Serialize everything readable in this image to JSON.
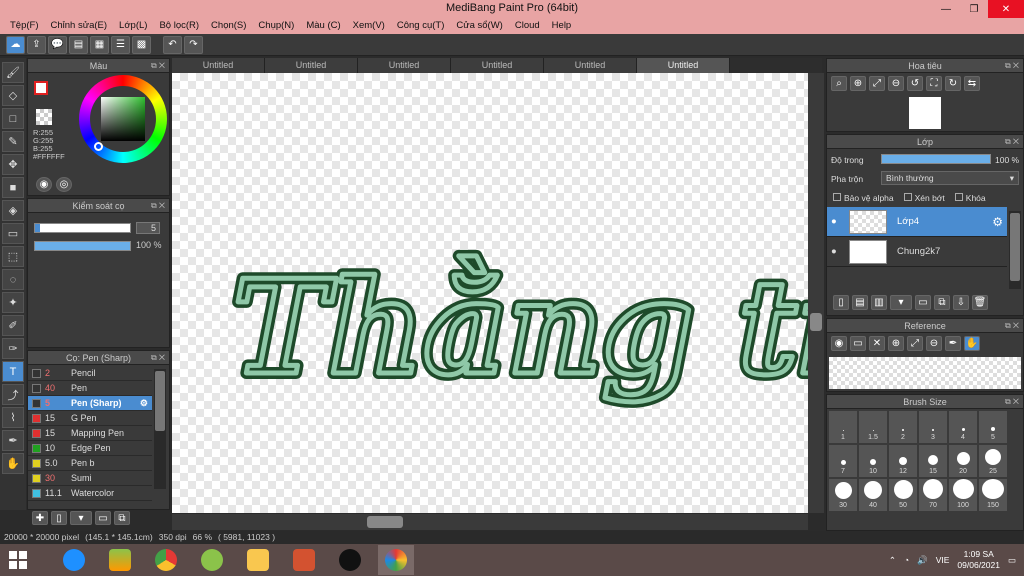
{
  "window": {
    "title": "MediBang Paint Pro (64bit)"
  },
  "menu": [
    "Tệp(F)",
    "Chỉnh sửa(E)",
    "Lớp(L)",
    "Bộ lọc(R)",
    "Chọn(S)",
    "Chụp(N)",
    "Màu (C)",
    "Xem(V)",
    "Công cụ(T)",
    "Cửa sổ(W)",
    "Cloud",
    "Help"
  ],
  "color_panel": {
    "title": "Màu",
    "r": "R:255",
    "g": "G:255",
    "b": "B:255",
    "hex": "#FFFFFF"
  },
  "brush_control": {
    "title": "Kiểm soát cọ",
    "size": "5",
    "opacity": "100 %"
  },
  "brush_panel": {
    "title": "Cọ: Pen (Sharp)",
    "items": [
      {
        "size": "2",
        "name": "Pencil",
        "color": "#333333"
      },
      {
        "size": "40",
        "name": "Pen",
        "color": "#333333"
      },
      {
        "size": "5",
        "name": "Pen (Sharp)",
        "color": "#333333"
      },
      {
        "size": "15",
        "name": "G Pen",
        "color": "#e03030"
      },
      {
        "size": "15",
        "name": "Mapping Pen",
        "color": "#e03030"
      },
      {
        "size": "10",
        "name": "Edge Pen",
        "color": "#20a020"
      },
      {
        "size": "5.0",
        "name": "Pen b",
        "color": "#e0d020"
      },
      {
        "size": "30",
        "name": "Sumi",
        "color": "#e0d020"
      },
      {
        "size": "11.1",
        "name": "Watercolor",
        "color": "#40c0e0"
      }
    ]
  },
  "tabs": [
    "Untitled",
    "Untitled",
    "Untitled",
    "Untitled",
    "Untitled",
    "Untitled"
  ],
  "canvas_text": "Thằng tiến",
  "navigator": {
    "title": "Hoa tiêu"
  },
  "layer_panel": {
    "title": "Lớp",
    "opacity_label": "Độ trong",
    "opacity_value": "100 %",
    "blend_label": "Pha trộn",
    "blend_value": "Bình thường",
    "protect_alpha": "Bảo vệ alpha",
    "clipping": "Xén bớt",
    "lock": "Khóa",
    "layers": [
      {
        "name": "Lớp4"
      },
      {
        "name": "Chung2k7"
      }
    ]
  },
  "reference": {
    "title": "Reference"
  },
  "brush_size": {
    "title": "Brush Size",
    "sizes": [
      "1",
      "1.5",
      "2",
      "3",
      "4",
      "5",
      "7",
      "10",
      "12",
      "15",
      "20",
      "25",
      "30",
      "40",
      "50",
      "70",
      "100",
      "150"
    ]
  },
  "status": {
    "dimensions": "20000 * 20000 pixel",
    "physical": "(145.1 * 145.1cm)",
    "dpi": "350 dpi",
    "zoom": "66 %",
    "coords": "( 5981, 11023 )"
  },
  "tray": {
    "lang": "VIE",
    "time": "1:09 SA",
    "date": "09/06/2021"
  },
  "colors": {
    "accent": "#4a8cd0",
    "titlebar": "#e8a4a4",
    "ink_dark": "#1e4a2a",
    "ink_light": "#8fc8a8"
  }
}
